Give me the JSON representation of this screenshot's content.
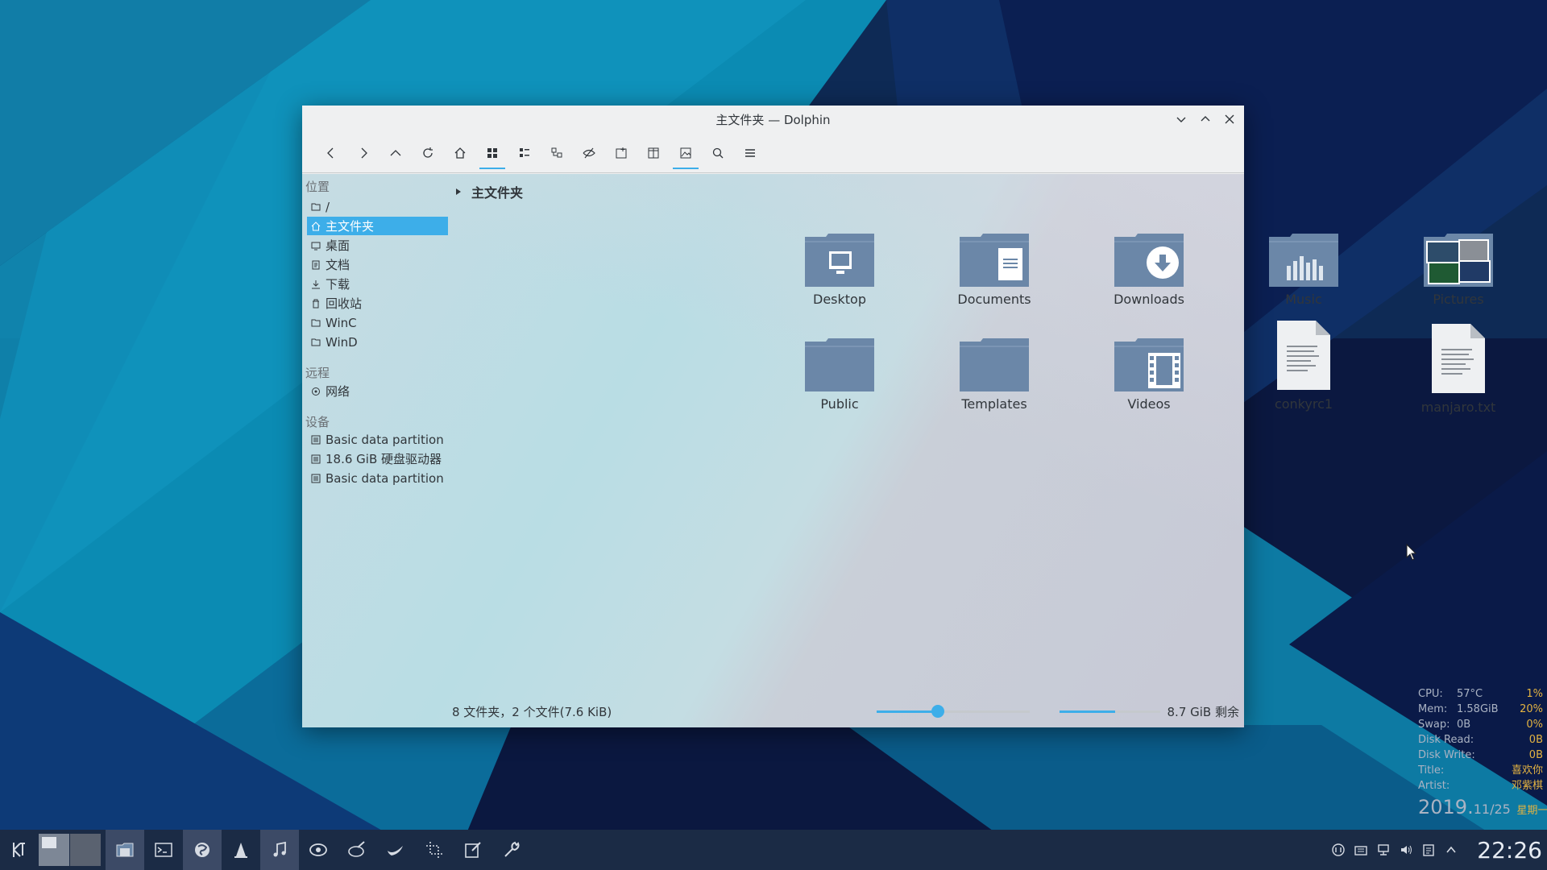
{
  "window": {
    "title": "主文件夹 — Dolphin"
  },
  "sidebar": {
    "sections": {
      "places": "位置",
      "remote": "远程",
      "devices": "设备"
    },
    "places": [
      "/",
      "主文件夹",
      "桌面",
      "文档",
      "下载",
      "回收站",
      "WinC",
      "WinD"
    ],
    "remote": [
      "网络"
    ],
    "devices": [
      "Basic data partition",
      "18.6 GiB 硬盘驱动器",
      "Basic data partition"
    ],
    "selected": "主文件夹"
  },
  "breadcrumb": {
    "current": "主文件夹"
  },
  "files": [
    {
      "name": "Desktop",
      "icon": "folder-desktop-icon"
    },
    {
      "name": "Documents",
      "icon": "folder-documents-icon"
    },
    {
      "name": "Downloads",
      "icon": "folder-downloads-icon"
    },
    {
      "name": "Music",
      "icon": "folder-music-icon"
    },
    {
      "name": "Pictures",
      "icon": "folder-pictures-icon"
    },
    {
      "name": "Public",
      "icon": "folder-icon"
    },
    {
      "name": "Templates",
      "icon": "folder-icon"
    },
    {
      "name": "Videos",
      "icon": "folder-videos-icon"
    },
    {
      "name": "conkyrc1",
      "icon": "text-file-icon"
    },
    {
      "name": "manjaro.txt",
      "icon": "text-file-icon"
    }
  ],
  "status": {
    "summary": "8 文件夹，2 个文件(7.6 KiB)",
    "free_space": "8.7 GiB 剩余",
    "zoom_fraction": 0.4,
    "disk_used_fraction": 0.55
  },
  "conky": {
    "rows": [
      {
        "k": "CPU:",
        "v": "57°C",
        "p": "1%"
      },
      {
        "k": "Mem:",
        "v": "1.58GiB",
        "p": "20%"
      },
      {
        "k": "Swap:",
        "v": "0B",
        "p": "0%"
      },
      {
        "k": "Disk Read:",
        "v": "",
        "p": "0B"
      },
      {
        "k": "Disk Write:",
        "v": "",
        "p": "0B"
      }
    ],
    "title_label": "Title:",
    "title_value": "喜欢你",
    "artist_label": "Artist:",
    "artist_value": "邓紫棋",
    "date_year": "2019.",
    "date_md": "11/25",
    "weekday": "星期一"
  },
  "taskbar": {
    "clock": "22:26"
  },
  "colors": {
    "accent": "#3daee9",
    "folder": "#6b87a8",
    "conky_highlight": "#e3b341"
  }
}
